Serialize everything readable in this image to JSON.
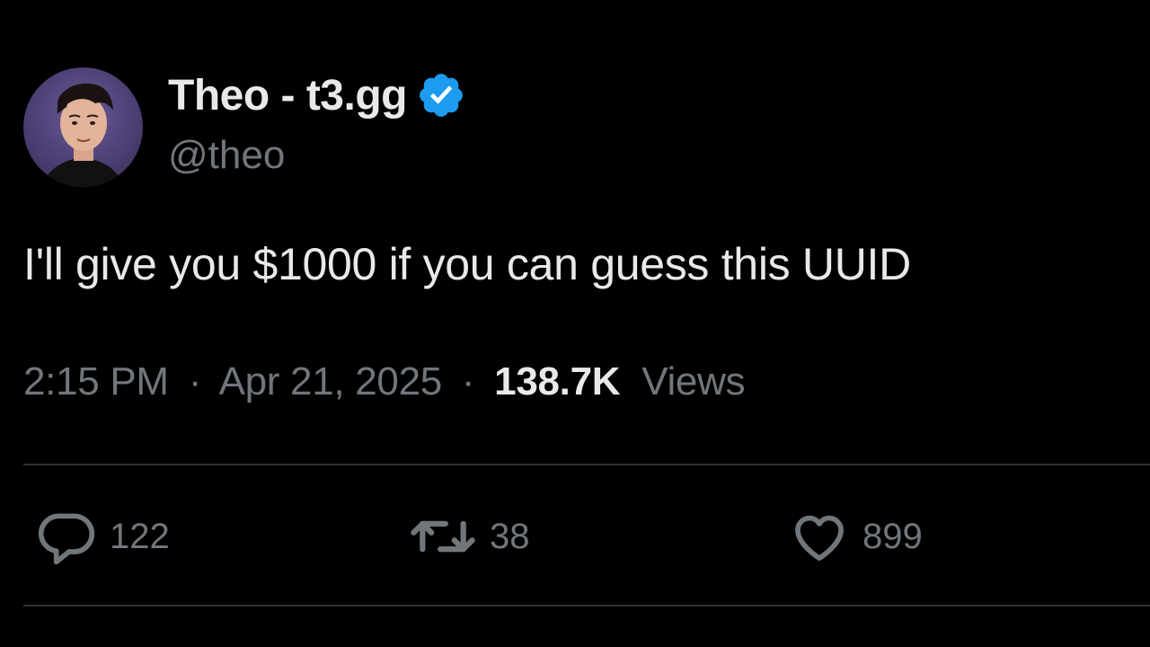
{
  "author": {
    "display_name": "Theo - t3.gg",
    "handle": "@theo",
    "verified": true,
    "verified_color": "#1d9bf0"
  },
  "tweet": {
    "text": "I'll give you $1000 if you can guess this UUID",
    "time": "2:15 PM",
    "separator": "·",
    "date": "Apr 21, 2025",
    "views_count": "138.7K",
    "views_label": "Views"
  },
  "actions": {
    "reply": {
      "icon": "reply-icon",
      "count": "122"
    },
    "retweet": {
      "icon": "retweet-icon",
      "count": "38"
    },
    "like": {
      "icon": "heart-icon",
      "count": "899"
    }
  },
  "colors": {
    "background": "#000000",
    "primary_text": "#e7e9ea",
    "secondary_text": "#71767b",
    "divider": "#2f3336"
  }
}
